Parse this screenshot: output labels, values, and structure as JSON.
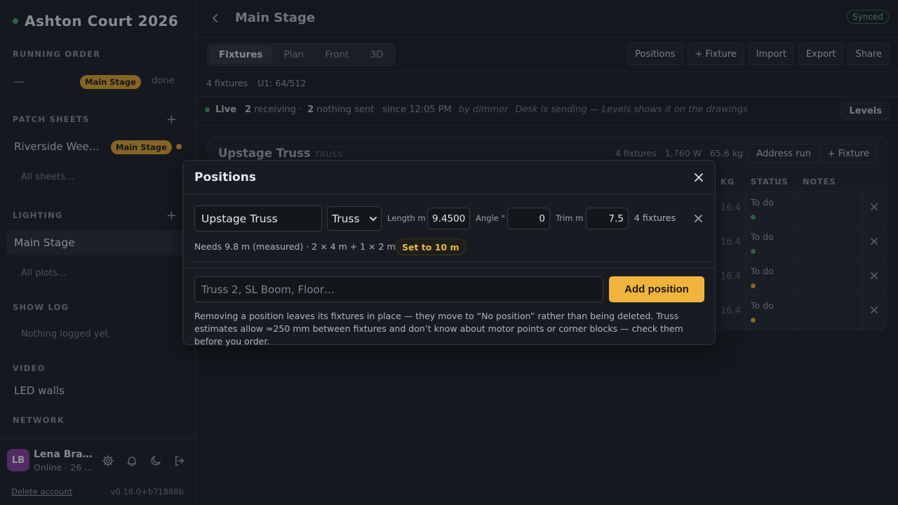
{
  "app": {
    "title": "Ashton Court 2026"
  },
  "sidebar": {
    "running_order": {
      "label": "RUNNING ORDER",
      "dash": "—",
      "badge": "Main Stage",
      "status": "done"
    },
    "patch_sheets": {
      "label": "PATCH SHEETS",
      "add": "+",
      "item": "Riverside Wee…",
      "badge": "Main Stage",
      "all": "All sheets…"
    },
    "lighting": {
      "label": "LIGHTING",
      "add": "+",
      "item": "Main Stage",
      "all": "All plots…"
    },
    "show_log": {
      "label": "SHOW LOG",
      "empty": "Nothing logged yet"
    },
    "video": {
      "label": "VIDEO",
      "item": "LED walls"
    },
    "network": {
      "label": "NETWORK"
    },
    "user": {
      "initials": "LB",
      "name": "Lena Bra…",
      "status": "Online · 26 …"
    },
    "footer": {
      "delete": "Delete account",
      "version": "v0.16.0+b71888b"
    }
  },
  "header": {
    "title": "Main Stage",
    "synced": "Synced"
  },
  "tabs": [
    "Fixtures",
    "Plan",
    "Front",
    "3D"
  ],
  "toolbar": [
    "Positions",
    "+ Fixture",
    "Import",
    "Export",
    "Share"
  ],
  "summary": {
    "fixtures": "4 fixtures",
    "universe": "U1: 64/512"
  },
  "live": {
    "label": "Live",
    "receiving_n": "2",
    "receiving": "receiving ·",
    "nothing_n": "2",
    "nothing": "nothing sent",
    "since": "since 12:05 PM",
    "by": "by dimmer",
    "desk": "Desk is sending — Levels shows it on the drawings",
    "levels_btn": "Levels"
  },
  "panel": {
    "name": "Upstage Truss",
    "kind": "TRUSS",
    "meta": [
      "4 fixtures",
      "1,760 W",
      "65.6 kg"
    ],
    "address_run": "Address run",
    "add_fixture": "+ Fixture",
    "columns": {
      "kg": "KG",
      "status": "STATUS",
      "notes": "NOTES"
    },
    "rows": [
      {
        "kg": "16.4",
        "status": "To do",
        "dot": "#3f8f5a"
      },
      {
        "kg": "16.4",
        "status": "To do",
        "dot": "#3f8f5a"
      },
      {
        "kg": "16.4",
        "status": "To do",
        "dot": "#c8962e"
      },
      {
        "kg": "16.4",
        "status": "To do",
        "dot": "#c8962e"
      }
    ]
  },
  "modal": {
    "title": "Positions",
    "position": {
      "name": "Upstage Truss",
      "type": "Truss",
      "length_label": "Length m",
      "length": "9.4500",
      "angle_label": "Angle °",
      "angle": "0",
      "trim_label": "Trim m",
      "trim": "7.5",
      "fixtures": "4 fixtures"
    },
    "needs": "Needs 9.8 m (measured) · 2 × 4 m + 1 × 2 m",
    "set_btn": "Set to 10 m",
    "add_placeholder": "Truss 2, SL Boom, Floor…",
    "add_btn": "Add position",
    "note": "Removing a position leaves its fixtures in place — they move to “No position” rather than being deleted. Truss estimates allow ≈250 mm between fixtures and don’t know about motor points or corner blocks — check them before you order."
  }
}
